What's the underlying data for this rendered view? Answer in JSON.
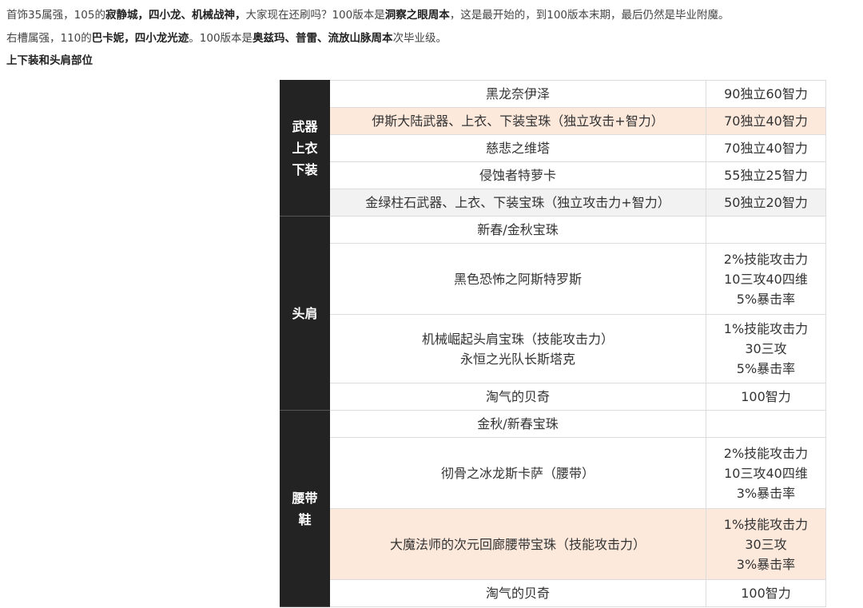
{
  "paragraphs": [
    [
      {
        "t": "首饰35属强，105的",
        "b": false
      },
      {
        "t": "寂静城，四小龙、机械战神，",
        "b": true
      },
      {
        "t": "大家现在还刷吗？100版本是",
        "b": false
      },
      {
        "t": "洞察之眼周本",
        "b": true
      },
      {
        "t": "，这是最开始的，到100版本末期，最后仍然是毕业附魔。",
        "b": false
      }
    ],
    [
      {
        "t": "右槽属强，110的",
        "b": false
      },
      {
        "t": "巴卡妮，四小龙光迹",
        "b": true
      },
      {
        "t": "。100版本是",
        "b": false
      },
      {
        "t": "奥兹玛、普雷、流放山脉周本",
        "b": true
      },
      {
        "t": "次毕业级。",
        "b": false
      }
    ]
  ],
  "section_heading": "上下装和头肩部位",
  "groups": [
    {
      "category": [
        "武器",
        "上衣",
        "下装"
      ],
      "rows": [
        {
          "name": [
            "黑龙奈伊泽"
          ],
          "value": [
            "90独立60智力"
          ],
          "style": ""
        },
        {
          "name": [
            "伊斯大陆武器、上衣、下装宝珠（独立攻击+智力）"
          ],
          "value": [
            "70独立40智力"
          ],
          "style": "hl"
        },
        {
          "name": [
            "慈悲之维塔"
          ],
          "value": [
            "70独立40智力"
          ],
          "style": ""
        },
        {
          "name": [
            "侵蚀者特萝卡"
          ],
          "value": [
            "55独立25智力"
          ],
          "style": ""
        },
        {
          "name": [
            "金绿柱石武器、上衣、下装宝珠（独立攻击力+智力）"
          ],
          "value": [
            "50独立20智力"
          ],
          "style": "gr"
        }
      ]
    },
    {
      "category": [
        "头肩"
      ],
      "rows": [
        {
          "name": [
            "新春/金秋宝珠"
          ],
          "value": [],
          "style": ""
        },
        {
          "name": [
            "黑色恐怖之阿斯特罗斯"
          ],
          "value": [
            "2%技能攻击力",
            "10三攻40四维",
            "5%暴击率"
          ],
          "style": ""
        },
        {
          "name": [
            "机械崛起头肩宝珠（技能攻击力）",
            "永恒之光队长斯塔克"
          ],
          "value": [
            "1%技能攻击力",
            "30三攻",
            "5%暴击率"
          ],
          "style": ""
        },
        {
          "name": [
            "淘气的贝奇"
          ],
          "value": [
            "100智力"
          ],
          "style": ""
        }
      ]
    },
    {
      "category": [
        "腰带",
        "鞋"
      ],
      "rows": [
        {
          "name": [
            "金秋/新春宝珠"
          ],
          "value": [],
          "style": ""
        },
        {
          "name": [
            "彻骨之冰龙斯卡萨（腰带）"
          ],
          "value": [
            "2%技能攻击力",
            "10三攻40四维",
            "3%暴击率"
          ],
          "style": ""
        },
        {
          "name": [
            "大魔法师的次元回廊腰带宝珠（技能攻击力）"
          ],
          "value": [
            "1%技能攻击力",
            "30三攻",
            "3%暴击率"
          ],
          "style": "hl"
        },
        {
          "name": [
            "淘气的贝奇"
          ],
          "value": [
            "100智力"
          ],
          "style": ""
        }
      ]
    }
  ]
}
